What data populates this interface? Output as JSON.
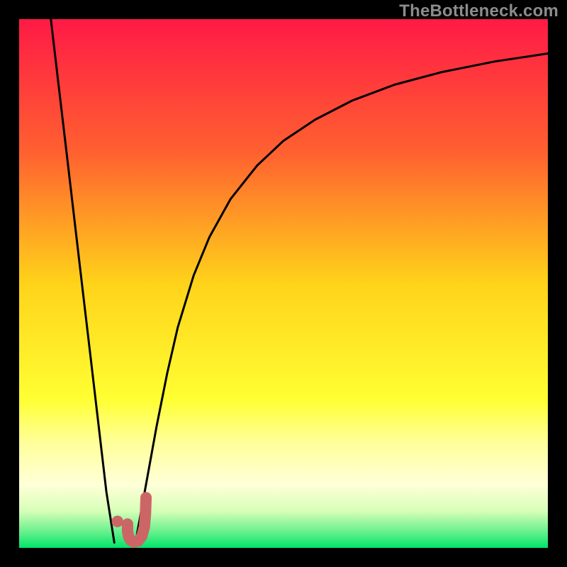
{
  "watermark": "TheBottleneck.com",
  "chart_data": {
    "type": "line",
    "title": "",
    "xlabel": "",
    "ylabel": "",
    "xlim": [
      0,
      100
    ],
    "ylim": [
      0,
      100
    ],
    "background_gradient": {
      "stops": [
        {
          "offset": 0.0,
          "color": "#ff1a46"
        },
        {
          "offset": 0.25,
          "color": "#ff6030"
        },
        {
          "offset": 0.5,
          "color": "#ffd31a"
        },
        {
          "offset": 0.72,
          "color": "#ffff33"
        },
        {
          "offset": 0.8,
          "color": "#ffff99"
        },
        {
          "offset": 0.88,
          "color": "#ffffd8"
        },
        {
          "offset": 0.93,
          "color": "#d8ffb8"
        },
        {
          "offset": 0.97,
          "color": "#66f08c"
        },
        {
          "offset": 1.0,
          "color": "#00e56b"
        }
      ]
    },
    "series": [
      {
        "name": "left-descent",
        "type": "line",
        "color": "#000000",
        "width": 3,
        "x": [
          6.0,
          7.5,
          9.0,
          10.5,
          12.0,
          13.5,
          15.0,
          16.5,
          18.0
        ],
        "y": [
          100.0,
          87.2,
          74.5,
          61.7,
          48.9,
          36.2,
          23.4,
          10.6,
          1.0
        ]
      },
      {
        "name": "right-ascent",
        "type": "line",
        "color": "#000000",
        "width": 3,
        "x": [
          22,
          24,
          26,
          28,
          30,
          33,
          36,
          40,
          45,
          50,
          56,
          63,
          71,
          80,
          90,
          100
        ],
        "y": [
          1.0,
          12.0,
          23.0,
          33.0,
          41.7,
          51.5,
          58.8,
          66.0,
          72.3,
          77.0,
          81.0,
          84.6,
          87.6,
          90.0,
          92.0,
          93.5
        ]
      },
      {
        "name": "j-hook",
        "type": "line",
        "color": "#cc6666",
        "width": 16,
        "x": [
          20.5,
          20.5,
          20.7,
          21.1,
          21.7,
          22.5,
          23.2,
          23.7,
          23.9,
          24.0
        ],
        "y": [
          4.5,
          3.2,
          2.1,
          1.4,
          1.1,
          1.3,
          2.2,
          4.0,
          6.5,
          9.5
        ]
      }
    ],
    "markers": [
      {
        "name": "j-dot",
        "x": 18.6,
        "y": 5.0,
        "r": 1.1,
        "color": "#cc6666"
      }
    ]
  }
}
